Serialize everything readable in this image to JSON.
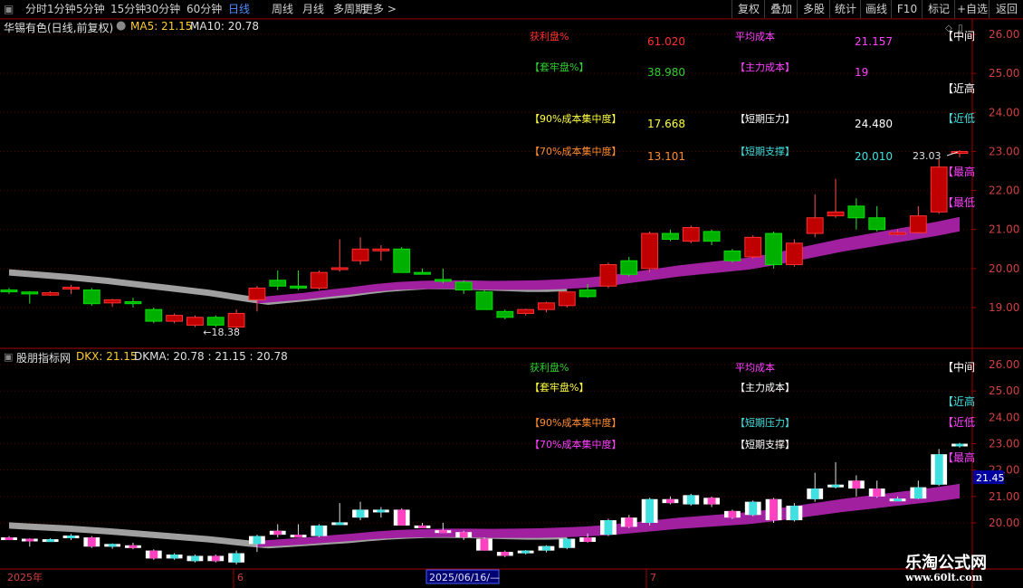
{
  "toolbar": {
    "left_items": [
      "分时",
      "1分钟",
      "5分钟",
      "15分钟",
      "30分钟",
      "60分钟",
      "日线",
      "周线",
      "月线",
      "多周期",
      "更多 >"
    ],
    "active": "日线",
    "right_items": [
      "复权",
      "叠加",
      "多股",
      "统计",
      "画线",
      "F10",
      "标记",
      "+自选",
      "返回"
    ]
  },
  "top_panel": {
    "title": "华锡有色(日线,前复权)",
    "ma5": "MA5: 21.15",
    "ma10": "MA10: 20.78",
    "stats": [
      {
        "label": "获利盘%",
        "value": "61.020",
        "label2": "平均成本",
        "value2": "21.157",
        "c1": "#ff3030",
        "c2": "#ff40ff"
      },
      {
        "label": "【套牢盘%】",
        "value": "38.980",
        "label2": "【主力成本】",
        "value2": "19",
        "c1": "#30d030",
        "c2": "#ff40ff"
      },
      {
        "label": "【90%成本集中度】",
        "value": "17.668",
        "label2": "【短期压力】",
        "value2": "24.480",
        "c1": "#ffff40",
        "c2": "#ffffff"
      },
      {
        "label": "【70%成本集中度】",
        "value": "13.101",
        "label2": "【短期支撑】",
        "value2": "20.010",
        "c1": "#ff8c30",
        "c2": "#40e0e0"
      }
    ],
    "right_markers": [
      "【中间",
      "【近高",
      "【近低",
      "【最高",
      "【最低"
    ],
    "annotation_high": "23.03",
    "annotation_low": "18.38",
    "axis_ticks": [
      "26.00",
      "25.00",
      "24.00",
      "23.00",
      "22.00",
      "21.00",
      "20.00",
      "19.00"
    ]
  },
  "bottom_panel": {
    "title": "股朋指标网",
    "dkx": "DKX: 21.15",
    "dkma": "DKMA: 20.78 : 21.15 : 20.78",
    "stats": [
      "获利盘%",
      "【套牢盘%】",
      "【90%成本集中度】",
      "【70%成本集中度】"
    ],
    "stats2": [
      "平均成本",
      "【主力成本】",
      "【短期压力】",
      "【短期支撑】"
    ],
    "right_markers": [
      "【中间",
      "【近高",
      "【近低",
      "【最高"
    ],
    "axis_ticks": [
      "26.00",
      "25.00",
      "24.00",
      "23.00",
      "22.00",
      "21.00",
      "20.00"
    ],
    "price_tag": "21.45"
  },
  "x_axis": {
    "labels": [
      "2025年",
      "6",
      "2025/06/16/—",
      "7"
    ]
  },
  "brand": {
    "name": "乐淘公式网",
    "url": "www.60lt.com"
  },
  "colors": {
    "up": "#ff2a2a",
    "down": "#00cc00",
    "cost_band": "#a020a0",
    "ma_gray": "#a0a0a0",
    "grid": "#5a0000"
  },
  "chart_data": {
    "type": "candlestick",
    "candles": [
      [
        19.45,
        19.42,
        19.35,
        19.5
      ],
      [
        19.4,
        19.35,
        19.1,
        19.42
      ],
      [
        19.32,
        19.38,
        19.3,
        19.42
      ],
      [
        19.5,
        19.52,
        19.35,
        19.58
      ],
      [
        19.45,
        19.1,
        19.05,
        19.5
      ],
      [
        19.12,
        19.2,
        19.02,
        19.22
      ],
      [
        19.15,
        19.1,
        19.0,
        19.25
      ],
      [
        18.95,
        18.65,
        18.6,
        19.0
      ],
      [
        18.65,
        18.8,
        18.6,
        18.85
      ],
      [
        18.55,
        18.75,
        18.5,
        18.8
      ],
      [
        18.75,
        18.55,
        18.5,
        18.8
      ],
      [
        18.5,
        18.85,
        18.42,
        18.95
      ],
      [
        19.2,
        19.5,
        18.9,
        19.55
      ],
      [
        19.7,
        19.55,
        19.45,
        19.95
      ],
      [
        19.55,
        19.5,
        19.45,
        19.95
      ],
      [
        19.5,
        19.9,
        19.45,
        19.95
      ],
      [
        20.0,
        20.02,
        19.92,
        20.75
      ],
      [
        20.2,
        20.5,
        20.1,
        20.8
      ],
      [
        20.48,
        20.5,
        20.2,
        20.6
      ],
      [
        20.5,
        19.9,
        19.9,
        20.55
      ],
      [
        19.9,
        19.88,
        19.85,
        20.0
      ],
      [
        19.72,
        19.68,
        19.62,
        20.0
      ],
      [
        19.65,
        19.45,
        19.35,
        19.7
      ],
      [
        19.4,
        18.95,
        18.95,
        19.45
      ],
      [
        18.9,
        18.75,
        18.7,
        18.95
      ],
      [
        18.85,
        18.95,
        18.8,
        18.97
      ],
      [
        18.95,
        19.12,
        18.88,
        19.15
      ],
      [
        19.05,
        19.4,
        19.0,
        19.42
      ],
      [
        19.45,
        19.28,
        19.25,
        19.6
      ],
      [
        19.55,
        20.1,
        19.5,
        20.15
      ],
      [
        20.2,
        19.85,
        19.8,
        20.3
      ],
      [
        20.0,
        20.9,
        19.9,
        20.95
      ],
      [
        20.9,
        20.75,
        20.7,
        21.0
      ],
      [
        20.7,
        21.05,
        20.65,
        21.1
      ],
      [
        20.95,
        20.7,
        20.6,
        21.0
      ],
      [
        20.45,
        20.2,
        20.15,
        20.5
      ],
      [
        20.3,
        20.8,
        20.25,
        20.85
      ],
      [
        20.9,
        20.1,
        20.0,
        20.95
      ],
      [
        20.1,
        20.65,
        20.05,
        20.75
      ],
      [
        20.9,
        21.3,
        20.8,
        21.9
      ],
      [
        21.35,
        21.45,
        21.3,
        22.3
      ],
      [
        21.6,
        21.3,
        21.0,
        21.8
      ],
      [
        21.3,
        21.0,
        20.95,
        21.6
      ],
      [
        20.92,
        20.92,
        20.85,
        21.0
      ],
      [
        20.92,
        21.35,
        20.9,
        21.6
      ],
      [
        21.45,
        22.6,
        21.4,
        22.8
      ],
      [
        22.95,
        23.0,
        22.85,
        23.03
      ]
    ],
    "ma_gray": [
      19.9,
      19.86,
      19.82,
      19.78,
      19.73,
      19.68,
      19.62,
      19.56,
      19.5,
      19.44,
      19.38,
      19.3,
      19.22,
      19.15,
      19.2,
      19.25,
      19.3,
      19.35,
      19.42,
      19.48,
      19.52,
      19.55,
      19.55,
      19.54,
      19.52,
      19.5,
      19.48,
      19.48,
      19.5
    ],
    "cost_band_mid": [
      19.15,
      19.2,
      19.25,
      19.32,
      19.38,
      19.45,
      19.5,
      19.52,
      19.53,
      19.52,
      19.5,
      19.5,
      19.5,
      19.52,
      19.55,
      19.6,
      19.68,
      19.76,
      19.84,
      19.9,
      19.96,
      20.02,
      20.12,
      20.24,
      20.36,
      20.48,
      20.58,
      20.68,
      20.78,
      20.88,
      21.0
    ],
    "ylim": [
      18.5,
      26.3
    ]
  }
}
